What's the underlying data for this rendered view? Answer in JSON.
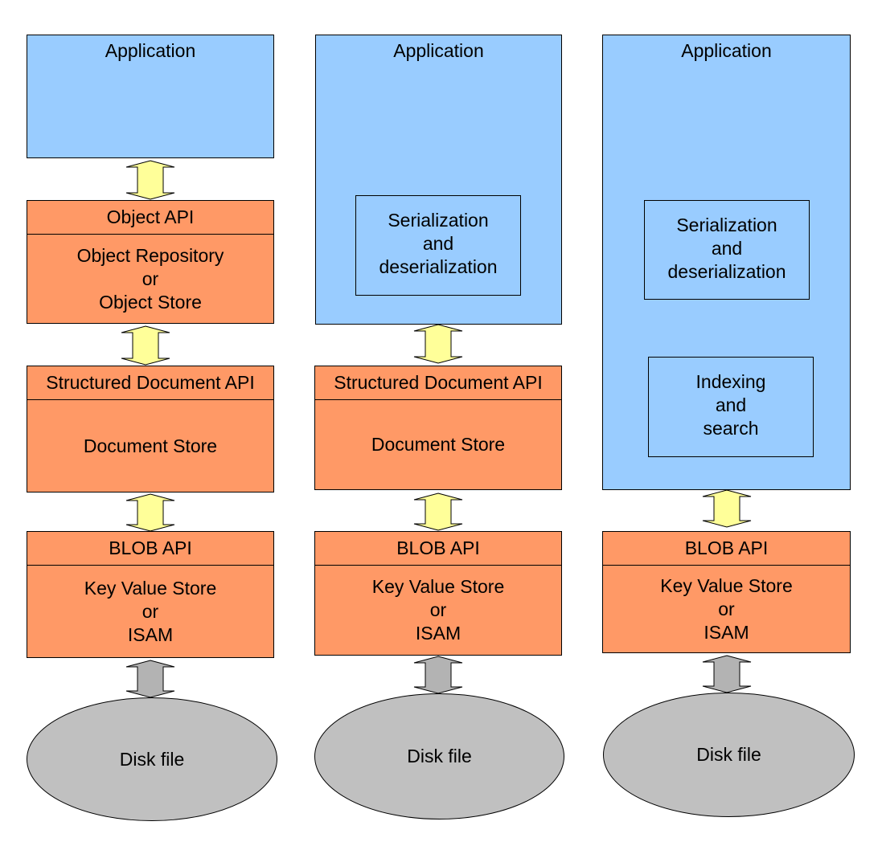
{
  "colors": {
    "application": "#99ccff",
    "layer": "#ff9966",
    "arrow_api": "#ffff99",
    "arrow_disk": "#b3b3b3",
    "disk": "#c0c0c0",
    "stroke": "#000000"
  },
  "columns": [
    {
      "application": {
        "title": "Application",
        "inner_boxes": []
      },
      "layers": [
        {
          "api": "Object API",
          "store_lines": [
            "Object Repository",
            "or",
            "Object Store"
          ]
        },
        {
          "api": "Structured Document API",
          "store_lines": [
            "Document Store"
          ]
        },
        {
          "api": "BLOB API",
          "store_lines": [
            "Key Value Store",
            "or",
            "ISAM"
          ]
        }
      ],
      "disk": "Disk file"
    },
    {
      "application": {
        "title": "Application",
        "inner_boxes": [
          {
            "lines": [
              "Serialization",
              "and",
              "deserialization"
            ]
          }
        ]
      },
      "layers": [
        {
          "api": "Structured Document API",
          "store_lines": [
            "Document Store"
          ]
        },
        {
          "api": "BLOB API",
          "store_lines": [
            "Key Value Store",
            "or",
            "ISAM"
          ]
        }
      ],
      "disk": "Disk file"
    },
    {
      "application": {
        "title": "Application",
        "inner_boxes": [
          {
            "lines": [
              "Serialization",
              "and",
              "deserialization"
            ]
          },
          {
            "lines": [
              "Indexing",
              "and",
              "search"
            ]
          }
        ]
      },
      "layers": [
        {
          "api": "BLOB API",
          "store_lines": [
            "Key Value Store",
            "or",
            "ISAM"
          ]
        }
      ],
      "disk": "Disk file"
    }
  ]
}
